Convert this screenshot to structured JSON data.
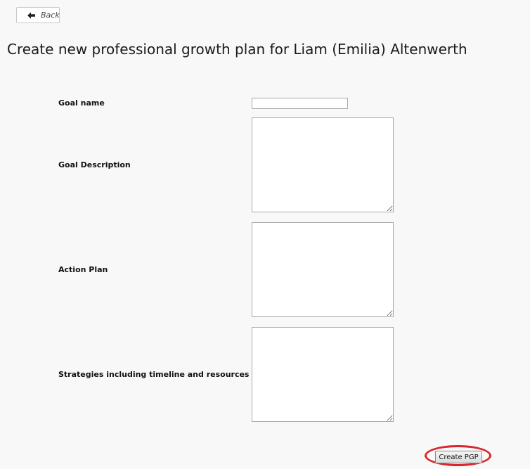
{
  "nav": {
    "back_label": "Back",
    "back_icon": "arrow-left-icon"
  },
  "page": {
    "title": "Create new professional growth plan for Liam (Emilia) Altenwerth"
  },
  "form": {
    "goal_name": {
      "label": "Goal name",
      "value": "",
      "placeholder": ""
    },
    "goal_description": {
      "label": "Goal Description",
      "value": ""
    },
    "action_plan": {
      "label": "Action Plan",
      "value": ""
    },
    "strategies": {
      "label": "Strategies including timeline and resources",
      "value": ""
    },
    "submit_label": "Create PGP",
    "highlight_color": "#d8262b"
  }
}
